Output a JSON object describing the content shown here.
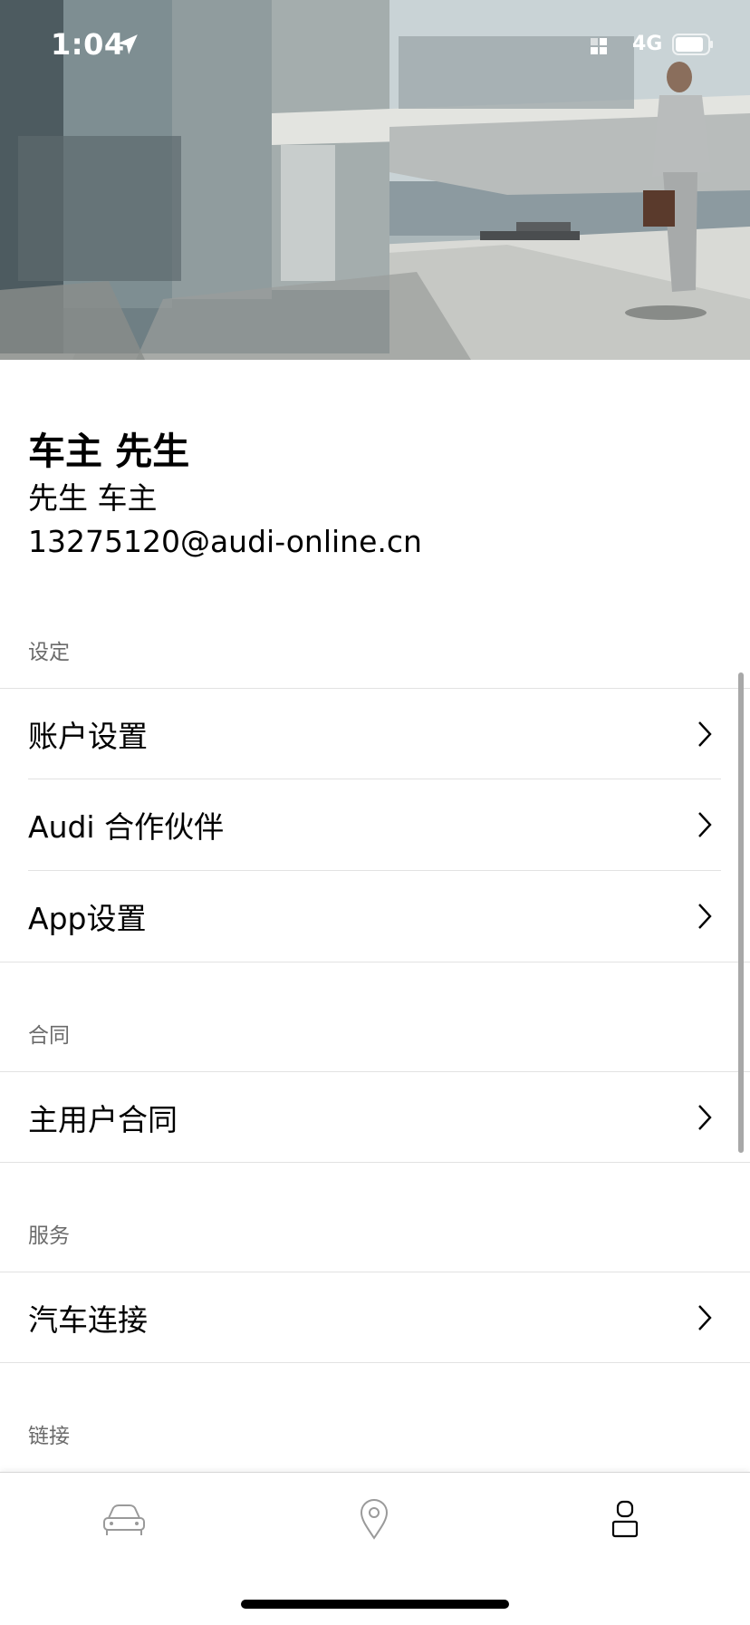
{
  "status_bar": {
    "time": "1:04",
    "network": "4G"
  },
  "profile": {
    "name": "车主 先生",
    "subtitle": "先生 车主",
    "email": "13275120@audi-online.cn"
  },
  "sections": {
    "settings": {
      "header": "设定",
      "items": [
        {
          "label": "账户设置"
        },
        {
          "label": "Audi 合作伙伴"
        },
        {
          "label": "App设置"
        }
      ]
    },
    "contracts": {
      "header": "合同",
      "items": [
        {
          "label": "主用户合同"
        }
      ]
    },
    "services": {
      "header": "服务",
      "items": [
        {
          "label": "汽车连接"
        }
      ]
    },
    "links": {
      "header": "链接"
    }
  },
  "tabs": [
    {
      "icon": "car-icon"
    },
    {
      "icon": "location-pin-icon"
    },
    {
      "icon": "person-icon",
      "active": true
    }
  ],
  "colors": {
    "text": "#000000",
    "section_header": "#6b6b6b",
    "divider": "#e2e2e2",
    "tab_inactive": "#9a9a9a",
    "tab_active": "#000000"
  }
}
